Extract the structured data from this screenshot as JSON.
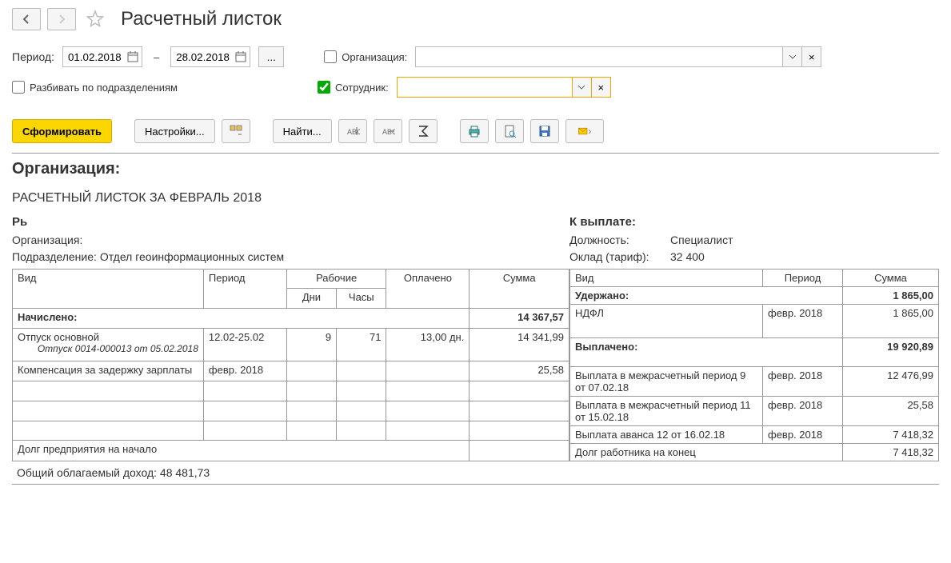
{
  "header": {
    "title": "Расчетный листок"
  },
  "filters": {
    "period_label": "Период:",
    "date_from": "01.02.2018",
    "date_to": "28.02.2018",
    "ellipsis": "...",
    "org_label": "Организация:",
    "emp_label": "Сотрудник:",
    "split_label": "Разбивать по подразделениям"
  },
  "toolbar": {
    "generate": "Сформировать",
    "settings": "Настройки...",
    "find": "Найти..."
  },
  "report": {
    "org_header": "Организация:",
    "title": "РАСЧЕТНЫЙ ЛИСТОК ЗА ФЕВРАЛЬ 2018",
    "pb": "Рь",
    "org_label": "Организация:",
    "dept_label": "Подразделение:",
    "dept_value": "Отдел геоинформационных систем",
    "payout_label": "К выплате:",
    "position_label": "Должность:",
    "position_value": "Специалист",
    "salary_label": "Оклад (тариф):",
    "salary_value": "32 400",
    "left": {
      "h_type": "Вид",
      "h_period": "Период",
      "h_work": "Рабочие",
      "h_paid": "Оплачено",
      "h_sum": "Сумма",
      "h_days": "Дни",
      "h_hours": "Часы",
      "accrued": "Начислено:",
      "accrued_sum": "14 367,57",
      "r1_type": "Отпуск основной",
      "r1_sub": "Отпуск 0014-000013 от 05.02.2018",
      "r1_period": "12.02-25.02",
      "r1_days": "9",
      "r1_hours": "71",
      "r1_paid": "13,00 дн.",
      "r1_sum": "14 341,99",
      "r2_type": "Компенсация за задержку зарплаты",
      "r2_period": "февр. 2018",
      "r2_sum": "25,58",
      "debt_start": "Долг предприятия на начало"
    },
    "right": {
      "h_type": "Вид",
      "h_period": "Период",
      "h_sum": "Сумма",
      "withheld": "Удержано:",
      "withheld_sum": "1 865,00",
      "r1_type": "НДФЛ",
      "r1_period": "февр. 2018",
      "r1_sum": "1 865,00",
      "paid": "Выплачено:",
      "paid_sum": "19 920,89",
      "r2_type": "Выплата в межрасчетный период 9 от 07.02.18",
      "r2_period": "февр. 2018",
      "r2_sum": "12 476,99",
      "r3_type": "Выплата в межрасчетный период 11 от 15.02.18",
      "r3_period": "февр. 2018",
      "r3_sum": "25,58",
      "r4_type": "Выплата аванса 12 от 16.02.18",
      "r4_period": "февр. 2018",
      "r4_sum": "7 418,32",
      "debt_end": "Долг работника на конец",
      "debt_end_sum": "7 418,32"
    },
    "total": "Общий облагаемый доход: 48 481,73"
  }
}
